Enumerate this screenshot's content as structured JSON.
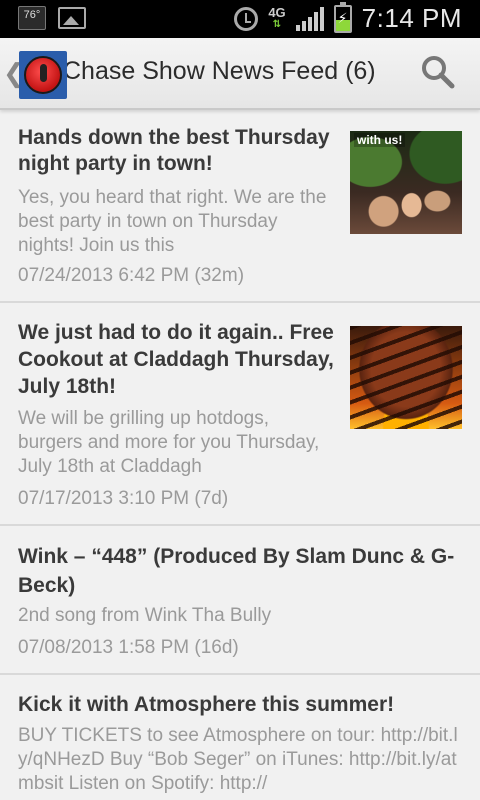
{
  "status_bar": {
    "badge_text": "76°",
    "network": "4G",
    "time": "7:14 PM"
  },
  "action_bar": {
    "title": "Chase Show News Feed (6)",
    "back_icon": "chevron-left-icon",
    "logo_icon": "microphone-logo-icon",
    "search_icon": "search-icon"
  },
  "feed": {
    "items": [
      {
        "title": "Hands down the best Thursday night party in town!",
        "summary": "Yes, you heard that right. We are the best party in town on Thursday nights! Join us this",
        "date": "07/24/2013 6:42 PM (32m)",
        "thumb_label": "with us!"
      },
      {
        "title": "We just had to do it again.. Free Cookout at Claddagh Thursday, July 18th!",
        "summary": "We will be grilling up hotdogs, burgers and more for you Thursday, July 18th  at Claddagh",
        "date": "07/17/2013 3:10 PM (7d)"
      },
      {
        "title": "Wink – “448” (Produced By Slam Dunc & G-Beck)",
        "summary": "2nd song from Wink Tha Bully",
        "date": "07/08/2013 1:58 PM (16d)"
      },
      {
        "title": "Kick it with Atmosphere this summer!",
        "summary": "BUY TICKETS to see Atmosphere on tour: http://bit.ly/qNHezD Buy “Bob Seger” on iTunes: http://bit.ly/atmbsit Listen on Spotify: http://"
      }
    ]
  },
  "colors": {
    "title_text": "#3a3a3a",
    "meta_text": "#9a9a9a",
    "background": "#f1f1f1",
    "divider": "#d9d9d9"
  }
}
